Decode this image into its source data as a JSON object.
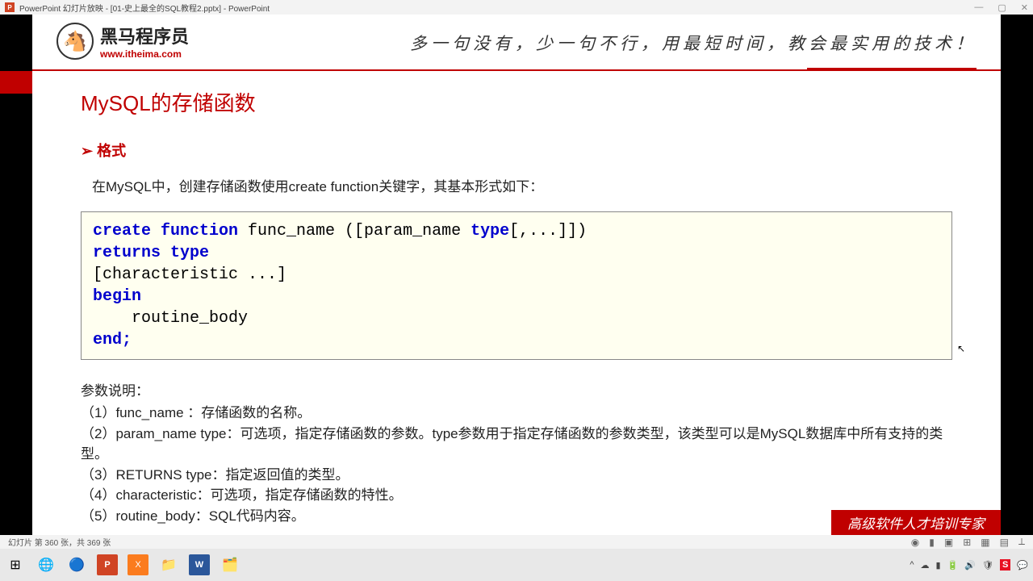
{
  "window": {
    "title": "PowerPoint 幻灯片放映 - [01-史上最全的SQL教程2.pptx] - PowerPoint"
  },
  "header": {
    "brand_cn": "黑马程序员",
    "brand_url": "www.itheima.com",
    "slogan": "多一句没有，少一句不行，用最短时间，教会最实用的技术！"
  },
  "slide": {
    "title": "MySQL的存储函数",
    "section_label": "格式",
    "intro": "在MySQL中，创建存储函数使用create function关键字，其基本形式如下：",
    "code": {
      "l1a": "create function",
      "l1b": " func_name ([param_name ",
      "l1c": "type",
      "l1d": "[,...]])",
      "l2": "returns type",
      "l3": "[characteristic ...]",
      "l4": "begin",
      "l5": "    routine_body",
      "l6": "end;"
    },
    "params_head": "参数说明：",
    "params": [
      "（1）func_name ：存储函数的名称。",
      "（2）param_name type：可选项，指定存储函数的参数。type参数用于指定存储函数的参数类型，该类型可以是MySQL数据库中所有支持的类型。",
      "（3）RETURNS type：指定返回值的类型。",
      "（4）characteristic：可选项，指定存储函数的特性。",
      "（5）routine_body：SQL代码内容。"
    ],
    "footer_badge": "高级软件人才培训专家"
  },
  "statusbar": {
    "left": "幻灯片 第 360 张，共 369 张"
  }
}
